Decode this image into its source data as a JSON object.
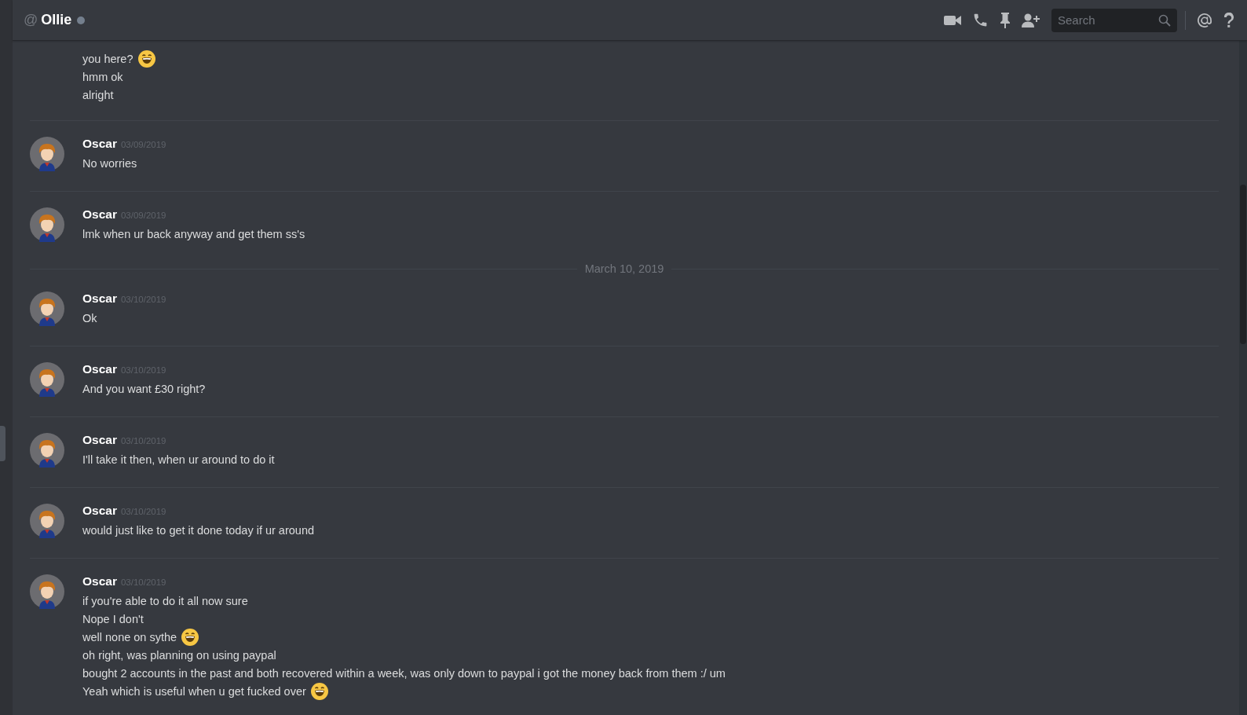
{
  "header": {
    "prefix": "@",
    "title": "Ollie",
    "search": {
      "placeholder": "Search"
    }
  },
  "messages": [
    {
      "kind": "continuation",
      "lines": [
        {
          "text": "you here?",
          "emoji": true
        },
        {
          "text": "hmm ok",
          "emoji": false
        },
        {
          "text": "alright",
          "emoji": false
        }
      ]
    },
    {
      "kind": "group",
      "author": "Oscar",
      "time": "03/09/2019",
      "lines": [
        {
          "text": "No worries",
          "emoji": false
        }
      ]
    },
    {
      "kind": "group",
      "author": "Oscar",
      "time": "03/09/2019",
      "lines": [
        {
          "text": "lmk when ur back anyway and get them ss's",
          "emoji": false
        }
      ]
    },
    {
      "kind": "date",
      "label": "March 10, 2019"
    },
    {
      "kind": "group",
      "author": "Oscar",
      "time": "03/10/2019",
      "lines": [
        {
          "text": "Ok",
          "emoji": false
        }
      ]
    },
    {
      "kind": "group",
      "author": "Oscar",
      "time": "03/10/2019",
      "lines": [
        {
          "text": "And you want £30 right?",
          "emoji": false
        }
      ]
    },
    {
      "kind": "group",
      "author": "Oscar",
      "time": "03/10/2019",
      "lines": [
        {
          "text": "I'll take it then, when ur around to do it",
          "emoji": false
        }
      ]
    },
    {
      "kind": "group",
      "author": "Oscar",
      "time": "03/10/2019",
      "lines": [
        {
          "text": "would just like to get it done today if ur around",
          "emoji": false
        }
      ]
    },
    {
      "kind": "group",
      "author": "Oscar",
      "time": "03/10/2019",
      "lines": [
        {
          "text": "if you're able to do it all now sure",
          "emoji": false
        },
        {
          "text": "Nope I don't",
          "emoji": false
        },
        {
          "text": "well none on sythe",
          "emoji": true
        },
        {
          "text": "oh right, was planning on using paypal",
          "emoji": false
        },
        {
          "text": "bought 2 accounts in the past and both recovered within a week, was only down to paypal i got the money back from them :/ um",
          "emoji": false
        },
        {
          "text": "Yeah which is useful when u get fucked over",
          "emoji": true
        }
      ]
    }
  ]
}
